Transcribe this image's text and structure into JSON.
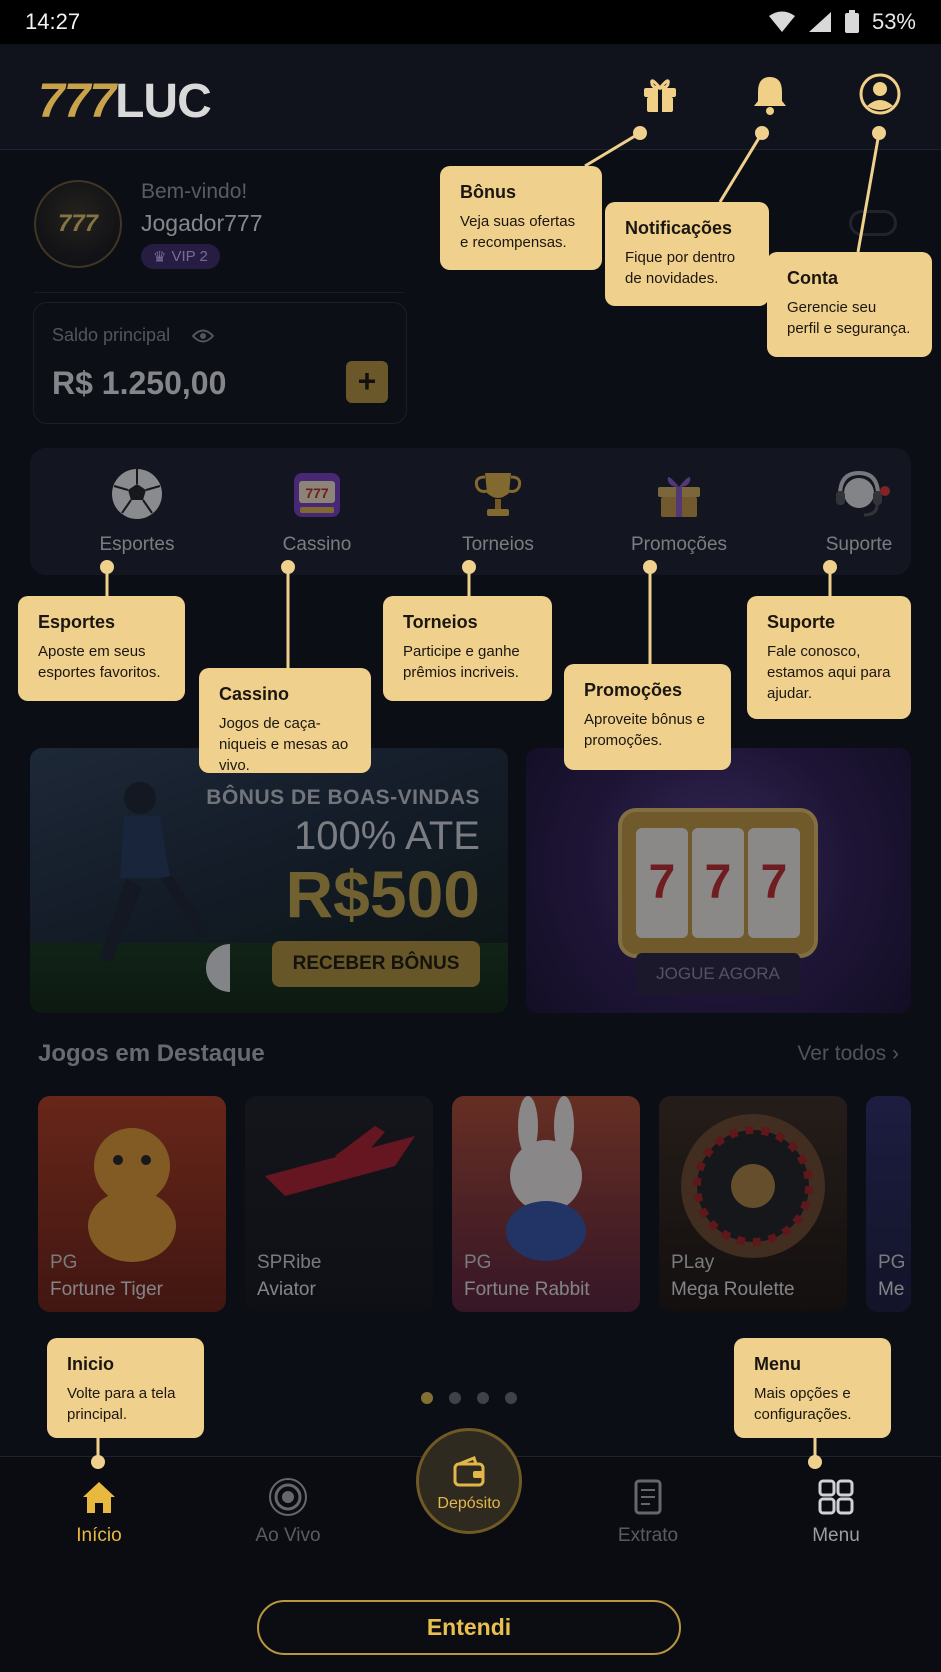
{
  "status_bar": {
    "time": "14:27",
    "battery": "53%"
  },
  "header": {
    "logo_number": "777",
    "logo_text": "LUC"
  },
  "profile": {
    "welcome": "Bem-vindo!",
    "username": "Jogador777",
    "avatar_text": "777",
    "vip": "VIP 2"
  },
  "balance": {
    "label": "Saldo principal",
    "amount": "R$ 1.250,00",
    "add_label": "+"
  },
  "categories": [
    {
      "label": "Esportes"
    },
    {
      "label": "Cassino"
    },
    {
      "label": "Torneios"
    },
    {
      "label": "Promoções"
    },
    {
      "label": "Suporte"
    }
  ],
  "banners": {
    "welcome": {
      "line1": "BÔNUS DE BOAS-VINDAS",
      "line2": "100% ATE",
      "line3": "R$500",
      "button": "RECEBER BÔNUS"
    },
    "slots": {
      "reels": [
        "7",
        "7",
        "7"
      ],
      "button": "JOGUE AGORA"
    }
  },
  "featured": {
    "title": "Jogos em Destaque",
    "see_all": "Ver todos",
    "games": [
      {
        "provider": "PG",
        "name": "Fortune Tiger"
      },
      {
        "provider": "SPRibe",
        "name": "Aviator"
      },
      {
        "provider": "PG",
        "name": "Fortune Rabbit"
      },
      {
        "provider": "PLay",
        "name": "Mega Roulette"
      },
      {
        "provider": "PG",
        "name": "Me"
      }
    ],
    "carousel": {
      "pages": 4,
      "active_page": 1
    }
  },
  "bottom_nav": {
    "home": "Início",
    "live": "Ao Vivo",
    "deposit": "Depósito",
    "statement": "Extrato",
    "menu": "Menu"
  },
  "tooltips": {
    "bonus": {
      "title": "Bônus",
      "desc": "Veja suas ofertas e recompensas."
    },
    "notifications": {
      "title": "Notificações",
      "desc": "Fique por dentro de novidades."
    },
    "account": {
      "title": "Conta",
      "desc": "Gerencie seu perfil e segurança."
    },
    "sports": {
      "title": "Esportes",
      "desc": "Aposte em seus esportes favoritos."
    },
    "casino": {
      "title": "Cassino",
      "desc": "Jogos de caça-niqueis e mesas ao vivo."
    },
    "tournaments": {
      "title": "Torneios",
      "desc": "Participe e ganhe prêmios incriveis."
    },
    "promotions": {
      "title": "Promoções",
      "desc": "Aproveite bônus e promoções."
    },
    "support": {
      "title": "Suporte",
      "desc": "Fale conosco, estamos aqui para ajudar."
    },
    "home": {
      "title": "Inicio",
      "desc": "Volte para a tela principal."
    },
    "menu": {
      "title": "Menu",
      "desc": "Mais opções e configurações."
    }
  },
  "confirm_button": "Entendi",
  "colors": {
    "accent": "#e9b93f",
    "tooltip": "#f0d08d",
    "background": "#0c0e15"
  }
}
